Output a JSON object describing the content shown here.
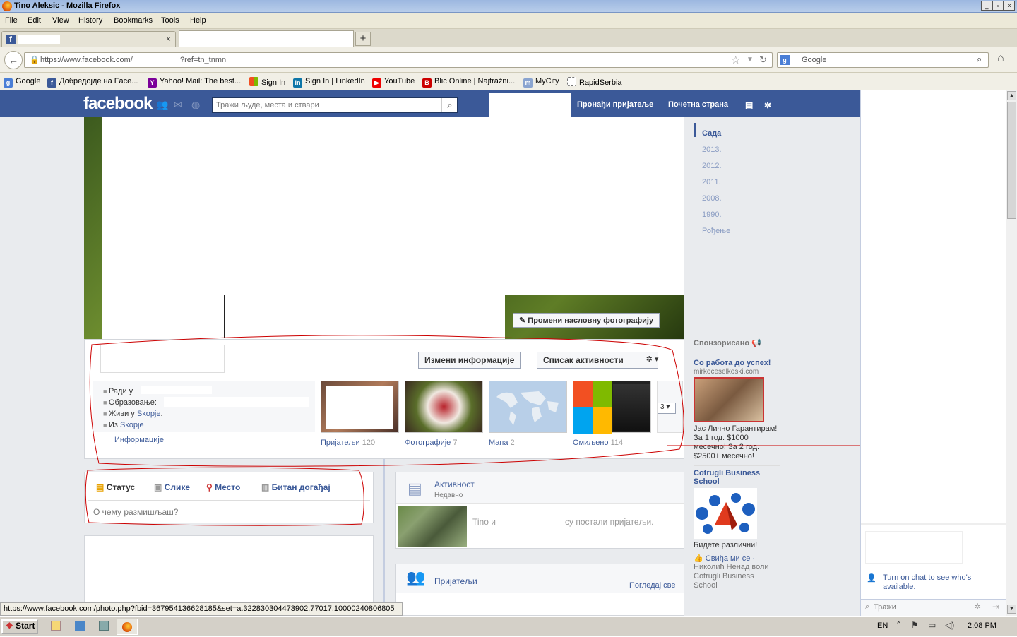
{
  "window": {
    "title": "Tino Aleksic - Mozilla Firefox"
  },
  "menu": [
    "File",
    "Edit",
    "View",
    "History",
    "Bookmarks",
    "Tools",
    "Help"
  ],
  "tabs": {
    "new_tab": "+"
  },
  "nav": {
    "url_prefix": "https://www.facebook.com/",
    "url_suffix": "?ref=tn_tnmn",
    "search_placeholder": "Google"
  },
  "bookmarks": [
    "Google",
    "Добредојде на Face...",
    "Yahoo! Mail: The best...",
    "Sign In",
    "Sign In | LinkedIn",
    "YouTube",
    "Blic Online | Najtražni...",
    "MyCity",
    "RapidSerbia"
  ],
  "fb": {
    "logo": "facebook",
    "search_placeholder": "Тражи људе, места и ствари",
    "find_friends": "Пронађи пријатеље",
    "home": "Почетна страна",
    "change_cover": "Промени насловну фотографију",
    "edit_info": "Измени информације",
    "activity_log": "Списак активности",
    "about": {
      "works": "Ради у",
      "education": "Образовање:",
      "lives_prefix": "Живи у",
      "lives_city": "Skopje",
      "from_prefix": "Из",
      "from_city": "Skopje",
      "info_link": "Информације"
    },
    "apps": [
      {
        "label": "Пријатељи",
        "count": "120"
      },
      {
        "label": "Фотографије",
        "count": "7"
      },
      {
        "label": "Мапа",
        "count": "2"
      },
      {
        "label": "Омиљено",
        "count": "114"
      }
    ],
    "more_count": "3",
    "timeline_years": [
      "Сада",
      "2013.",
      "2012.",
      "2011.",
      "2008.",
      "1990.",
      "Рођење"
    ],
    "composer": {
      "tabs": [
        "Статус",
        "Слике",
        "Место",
        "Битан догађај"
      ],
      "placeholder": "О чему размишљаш?"
    },
    "activity": {
      "title": "Активност",
      "subtitle": "Недавно",
      "story_left": "Tino и",
      "story_right": "су постали пријатељи."
    },
    "friends_box": {
      "title": "Пријатељи",
      "see_all": "Погледај све"
    },
    "sponsored": {
      "header": "Спонзорисано",
      "ad1_title": "Со работа до успех!",
      "ad1_domain": "mirkoceselkoski.com",
      "ad1_text": "Јас Лично Гарантирам! За 1 год. $1000 месечно! За 2 год. $2500+ месечно!",
      "ad2_title": "Cotrugli Business School",
      "ad2_text": "Бидете различни!",
      "ad2_like": "Свиђа ми се",
      "ad2_social": "Николић Ненад воли Cotrugli Business School"
    },
    "chat": {
      "turn_on": "Turn on chat to see who's available.",
      "search": "Тражи"
    }
  },
  "statusbar": "https://www.facebook.com/photo.php?fbid=367954136628185&set=a.322830304473902.77017.10000240806805",
  "taskbar": {
    "start": "Start",
    "lang": "EN",
    "time": "2:08 PM"
  }
}
